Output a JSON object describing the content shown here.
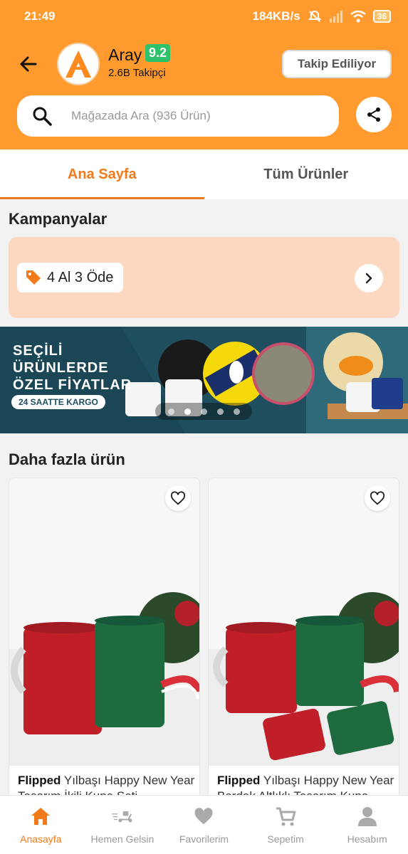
{
  "status_bar": {
    "time": "21:49",
    "network_speed": "184KB/s",
    "battery": "36"
  },
  "store": {
    "name": "Aray",
    "rating": "9.2",
    "followers": "2.6B Takipçi",
    "follow_label": "Takip Ediliyor",
    "logo_letter": "A"
  },
  "search": {
    "placeholder": "Mağazada Ara (936 Ürün)"
  },
  "tabs": [
    {
      "label": "Ana Sayfa",
      "active": true
    },
    {
      "label": "Tüm Ürünler",
      "active": false
    }
  ],
  "campaigns": {
    "title": "Kampanyalar",
    "chip_label": "4 Al 3 Öde"
  },
  "banner": {
    "line1": "SEÇİLİ",
    "line2": "ÜRÜNLERDE",
    "line3": "ÖZEL FİYATLAR",
    "pill": "24 SAATTE KARGO",
    "slide_count": 5,
    "active_slide": 2
  },
  "more_products": {
    "title": "Daha fazla ürün"
  },
  "products": [
    {
      "brand": "Flipped",
      "title": " Yılbaşı Happy New Year Tasarım İkili Kupa Seti"
    },
    {
      "brand": "Flipped",
      "title": " Yılbaşı Happy New Year Bardak Altlıklı Tasarım Kupa"
    }
  ],
  "bottom_nav": [
    {
      "label": "Anasayfa",
      "icon": "home-icon",
      "active": true
    },
    {
      "label": "Hemen Gelsin",
      "icon": "scooter-icon",
      "active": false
    },
    {
      "label": "Favorilerim",
      "icon": "heart-icon",
      "active": false
    },
    {
      "label": "Sepetim",
      "icon": "cart-icon",
      "active": false
    },
    {
      "label": "Hesabım",
      "icon": "user-icon",
      "active": false
    }
  ],
  "colors": {
    "brand_orange": "#ff9a2e",
    "accent": "#f27a1a",
    "rating_green": "#2ec26b"
  }
}
